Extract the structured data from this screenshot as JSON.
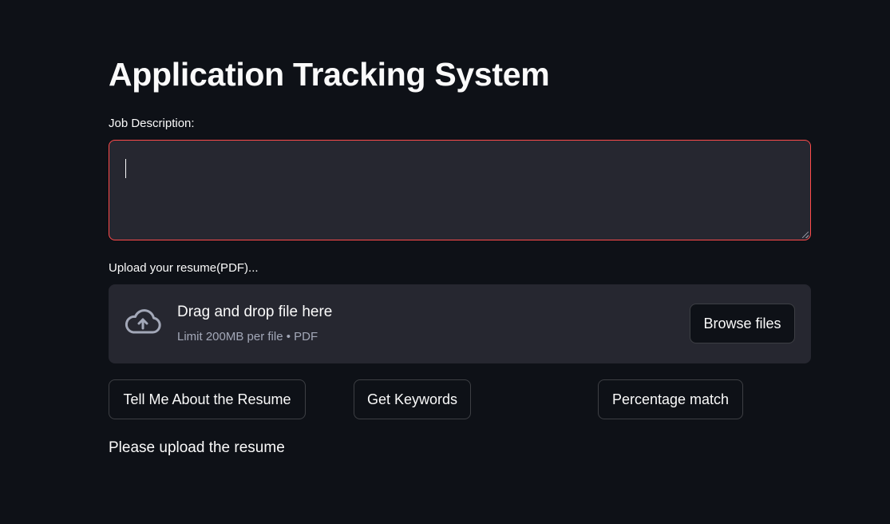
{
  "app": {
    "title": "Application Tracking System"
  },
  "job_description": {
    "label": "Job Description:",
    "value": "",
    "placeholder": ""
  },
  "uploader": {
    "label": "Upload your resume(PDF)...",
    "drop_title": "Drag and drop file here",
    "drop_subtitle": "Limit 200MB per file • PDF",
    "browse_label": "Browse files",
    "icon": "cloud-upload-icon"
  },
  "actions": {
    "tell_label": "Tell Me About the Resume",
    "keywords_label": "Get Keywords",
    "percentage_label": "Percentage match"
  },
  "status": {
    "message": "Please upload the resume"
  },
  "colors": {
    "background": "#0e1117",
    "surface": "#262730",
    "focus_border": "#ff4b4b",
    "text": "#fafafa",
    "muted_text": "#a3a8b8"
  }
}
